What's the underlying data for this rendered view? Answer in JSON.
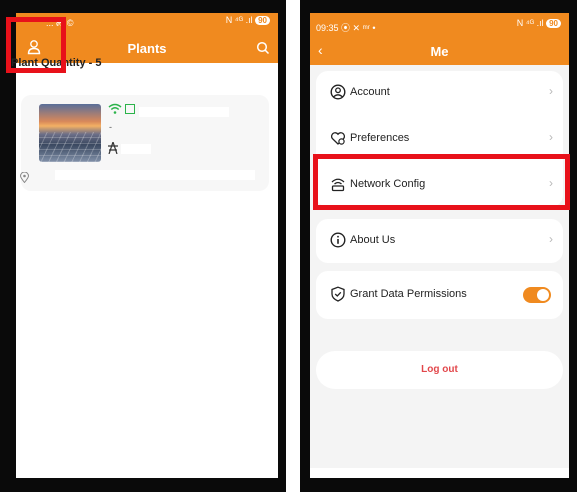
{
  "left_screen": {
    "status_bar": {
      "left": "... ๓ʳ ©",
      "right": "N ⁴ᴳ .ıl",
      "battery": "90"
    },
    "header": {
      "title": "Plants"
    },
    "plant_quantity": "Plant Quantity - 5",
    "plant_card": {
      "dash": "-"
    }
  },
  "right_screen": {
    "status_bar": {
      "time": "09:35",
      "left_icons": "⦿ ✕ ᵐʳ •",
      "right": "N ⁴ᴳ .ıl",
      "battery": "90"
    },
    "header": {
      "title": "Me",
      "back": "‹"
    },
    "menu": {
      "account": "Account",
      "preferences": "Preferences",
      "network_config": "Network Config",
      "about_us": "About Us",
      "grant_data_permissions": "Grant Data Permissions",
      "chevron": "›"
    },
    "grant_toggle_on": true,
    "logout": "Log out"
  },
  "colors": {
    "accent": "#f08a1f",
    "highlight": "#e8111a",
    "logout_text": "#e2474b",
    "online": "#2bb34a"
  }
}
